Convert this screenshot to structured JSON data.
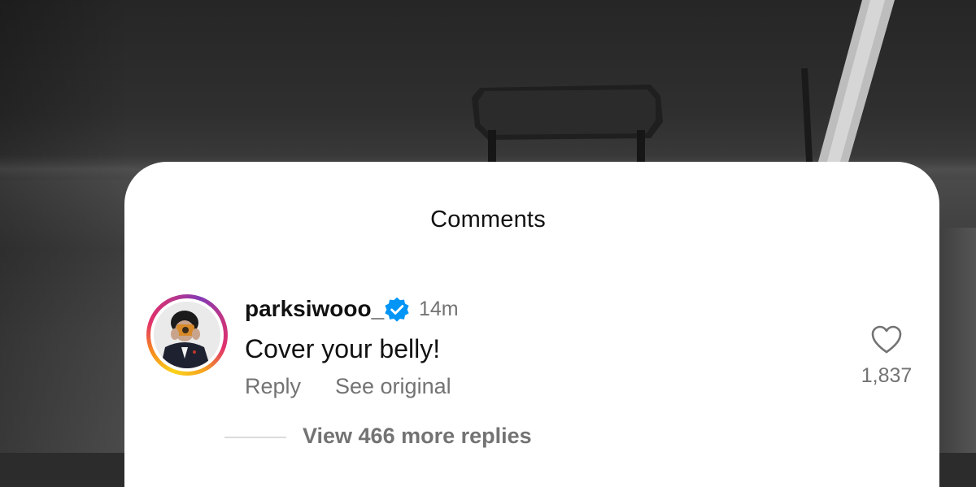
{
  "sheet": {
    "title": "Comments"
  },
  "comment": {
    "username": "parksiwooo_",
    "verified": true,
    "time": "14m",
    "text": "Cover your belly!",
    "reply_label": "Reply",
    "see_original_label": "See original",
    "like_count": "1,837",
    "view_replies_label": "View 466 more replies"
  },
  "colors": {
    "text_primary": "#111111",
    "text_secondary": "#737373",
    "verified_blue": "#0095f6",
    "sheet_background": "#ffffff"
  },
  "icons": {
    "verified": "verified-badge-icon",
    "like": "heart-outline-icon"
  }
}
